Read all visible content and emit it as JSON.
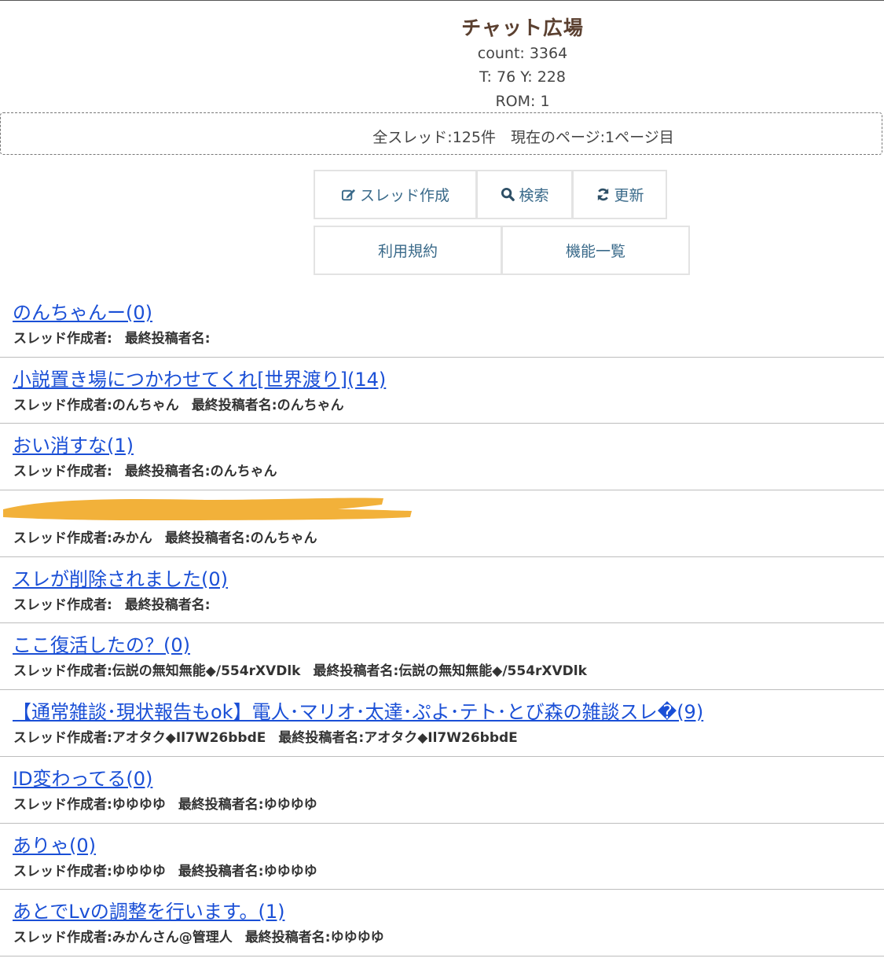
{
  "header": {
    "title": "チャット広場",
    "count": "count: 3364",
    "ty": "T: 76 Y: 228",
    "rom": "ROM: 1"
  },
  "info_bar": {
    "text": "全スレッド:125件　現在のページ:1ページ目"
  },
  "toolbar": {
    "create_label": "スレッド作成",
    "search_label": "検索",
    "refresh_label": "更新",
    "terms_label": "利用規約",
    "features_label": "機能一覧"
  },
  "threads": [
    {
      "title": "のんちゃんー(0)",
      "creator": "スレッド作成者:",
      "last_poster": "最終投稿者名:"
    },
    {
      "title": "小説置き場につかわせてくれ[世界渡り](14)",
      "creator": "スレッド作成者:のんちゃん",
      "last_poster": "最終投稿者名:のんちゃん"
    },
    {
      "title": "おい消すな(1)",
      "creator": "スレッド作成者:",
      "last_poster": "最終投稿者名:のんちゃん"
    },
    {
      "title": "",
      "creator": "スレッド作成者:みかん",
      "last_poster": "最終投稿者名:のんちゃん",
      "redacted": true
    },
    {
      "title": "スレが削除されました(0)",
      "creator": "スレッド作成者:",
      "last_poster": "最終投稿者名:"
    },
    {
      "title": "ここ復活したの？(0)",
      "creator": "スレッド作成者:伝説の無知無能◆/554rXVDlk",
      "last_poster": "最終投稿者名:伝説の無知無能◆/554rXVDlk"
    },
    {
      "title": "【通常雑談･現状報告もok】電人･マリオ･太達･ぷよ･テト･とび森の雑談スレ�(9)",
      "creator": "スレッド作成者:アオタク◆Il7W26bbdE",
      "last_poster": "最終投稿者名:アオタク◆Il7W26bbdE"
    },
    {
      "title": "ID変わってる(0)",
      "creator": "スレッド作成者:ゆゆゆゆ",
      "last_poster": "最終投稿者名:ゆゆゆゆ"
    },
    {
      "title": "ありゃ(0)",
      "creator": "スレッド作成者:ゆゆゆゆ",
      "last_poster": "最終投稿者名:ゆゆゆゆ"
    },
    {
      "title": "あとでLvの調整を行います。(1)",
      "creator": "スレッド作成者:みかんさん@管理人",
      "last_poster": "最終投稿者名:ゆゆゆゆ"
    }
  ],
  "colors": {
    "title_brown": "#5b4030",
    "link_blue": "#1a4fd6",
    "button_text": "#3a6a8a",
    "redaction_orange": "#f2b13a"
  },
  "icons": {
    "create": "edit-icon",
    "search": "search-icon",
    "refresh": "refresh-icon"
  }
}
